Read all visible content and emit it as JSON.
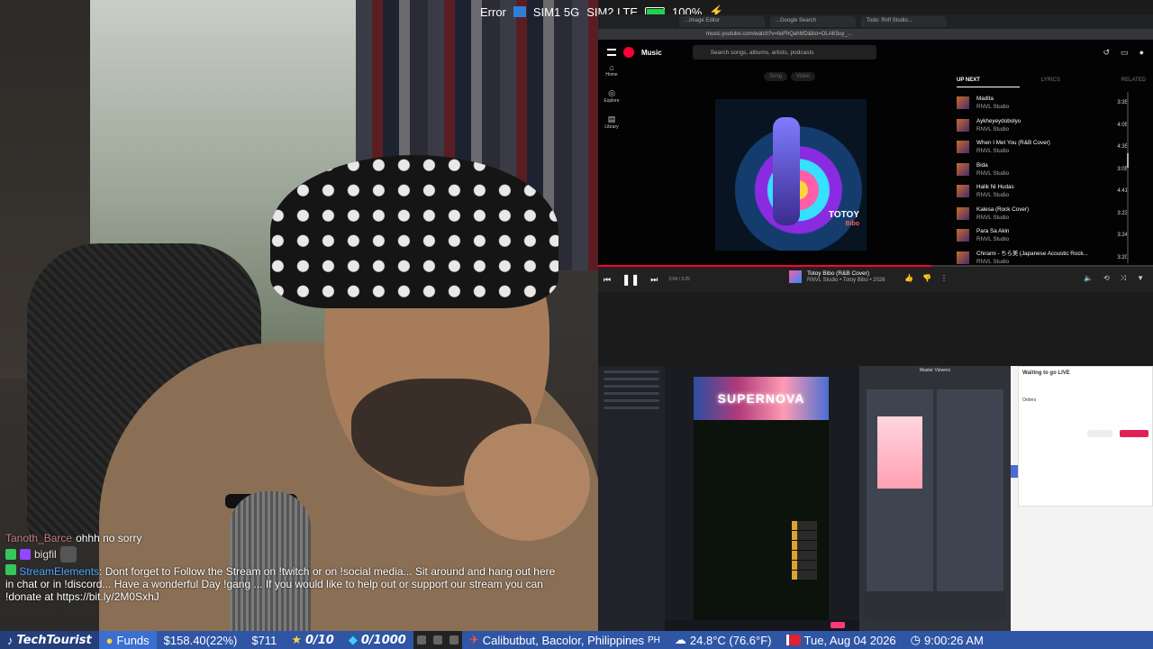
{
  "status_overlay": {
    "error": "Error",
    "sim1": "SIM1 5G",
    "sim2": "SIM2 LTE",
    "battery_pct": "100%",
    "battery_level": 1.0
  },
  "chat": {
    "user1": "Tanoth_Barce",
    "msg1": "ohhh no sorry",
    "user2": "bigfil",
    "user3": "StreamElements",
    "msg3": ": Dont forget to Follow the Stream on !twitch or on !social media... Sit around and hang out here in chat or in !discord... Have a wonderful Day !gang ... If you would like to help out or support our stream you can !donate at https://bit.ly/2M0SxhJ"
  },
  "browser": {
    "tabs": [
      "...Image Editor",
      "...Google Search",
      "Todo: Rnfl Studio..."
    ],
    "url": "music.youtube.com/watch?v=feiFhQahMD&list=OLAK5uy_..."
  },
  "ytmusic": {
    "logo": "Music",
    "search_placeholder": "Search songs, albums, artists, podcasts",
    "nav": {
      "home": "Home",
      "explore": "Explore",
      "library": "Library"
    },
    "song_tab": "Song",
    "video_tab": "Video",
    "art_title": "TOTOY",
    "art_subtitle": "Bibo",
    "panel_tabs": {
      "up_next": "UP NEXT",
      "lyrics": "LYRICS",
      "related": "RELATED"
    },
    "queue": [
      {
        "title": "Madita",
        "artist": "RNVL Studio",
        "duration": "3:35"
      },
      {
        "title": "Aykheyeydobolyu",
        "artist": "RNVL Studio",
        "duration": "4:05"
      },
      {
        "title": "When I Met You (R&B Cover)",
        "artist": "RNVL Studio",
        "duration": "4:35"
      },
      {
        "title": "Bida",
        "artist": "RNVL Studio",
        "duration": "3:05"
      },
      {
        "title": "Halik Ni Hudas",
        "artist": "RNVL Studio",
        "duration": "4:41"
      },
      {
        "title": "Kalesa (Rock Cover)",
        "artist": "RNVL Studio",
        "duration": "3:23"
      },
      {
        "title": "Para Sa Akin",
        "artist": "RNVL Studio",
        "duration": "3:24"
      },
      {
        "title": "Chirami - ちら美 (Japanese Acoustic Rock...",
        "artist": "RNVL Studio",
        "duration": "3:20"
      }
    ],
    "player": {
      "time": "2:04 / 3:25",
      "title": "Totoy Bibo (R&B Cover)",
      "subtitle": "RNVL Studio • Totoy Bibo • 2026",
      "progress": 0.6
    }
  },
  "obs": {
    "banner_text": "SUPERNOVA"
  },
  "panel2": {
    "title": "Master Viewers"
  },
  "panel3": {
    "title": "Waiting to go LIVE",
    "section": "Orders"
  },
  "ticker": {
    "channel": "TechTourist",
    "funds_label": "Funds",
    "funds_value": "$158.40(22%)",
    "amount": "$711",
    "stars": "0/10",
    "diamonds": "0/1000",
    "location": "Calibutbut, Bacolor, Philippines",
    "country": "PH",
    "temp": "24.8°C (76.6°F)",
    "date": "Tue, Aug 04 2026",
    "time": "9:00:26 AM"
  }
}
